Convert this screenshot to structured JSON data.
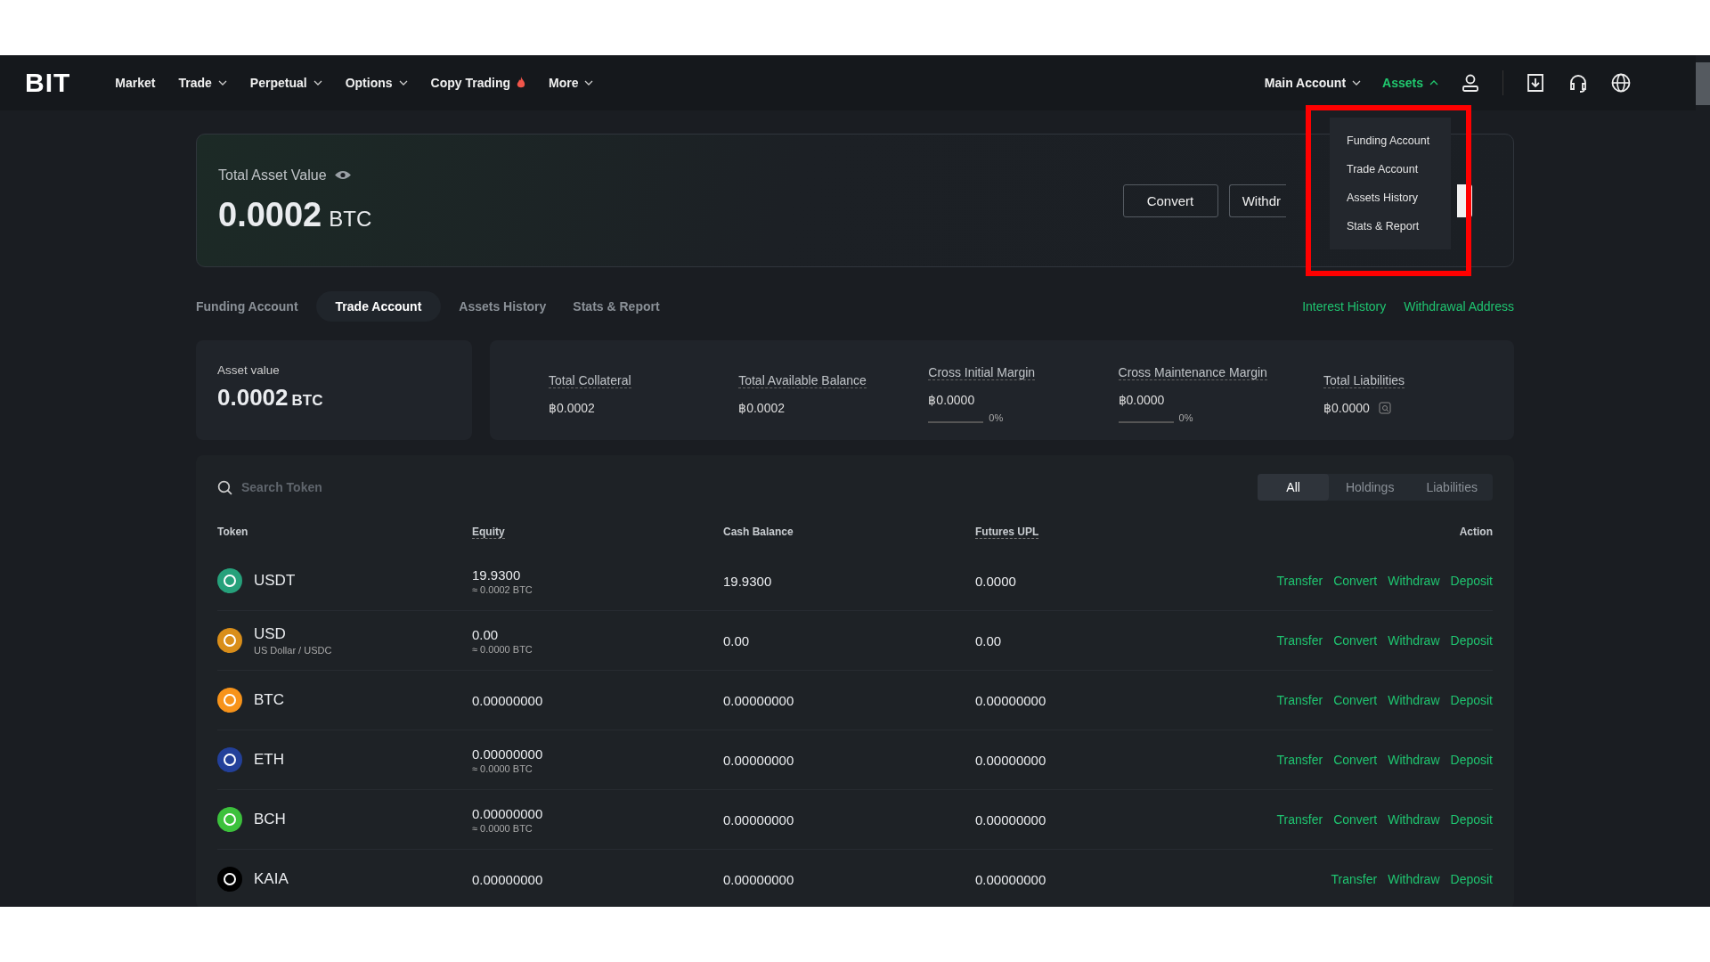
{
  "nav": {
    "logo": "BIT",
    "items": [
      {
        "label": "Market",
        "dropdown": false,
        "hot": false
      },
      {
        "label": "Trade",
        "dropdown": true,
        "hot": false
      },
      {
        "label": "Perpetual",
        "dropdown": true,
        "hot": false
      },
      {
        "label": "Options",
        "dropdown": true,
        "hot": false
      },
      {
        "label": "Copy Trading",
        "dropdown": false,
        "hot": true
      },
      {
        "label": "More",
        "dropdown": true,
        "hot": false
      }
    ],
    "account": "Main Account",
    "assets": {
      "label": "Assets",
      "expanded": true
    }
  },
  "assets_menu": {
    "items": [
      "Funding Account",
      "Trade Account",
      "Assets History",
      "Stats & Report"
    ]
  },
  "overview": {
    "title": "Total Asset Value",
    "value": "0.0002",
    "unit": "BTC",
    "buttons": [
      "Convert",
      "Withdr"
    ]
  },
  "tabs": [
    {
      "label": "Funding Account",
      "selected": false
    },
    {
      "label": "Trade Account",
      "selected": true
    },
    {
      "label": "Assets History",
      "selected": false
    },
    {
      "label": "Stats & Report",
      "selected": false
    }
  ],
  "links": [
    "Interest History",
    "Withdrawal Address"
  ],
  "asset_value": {
    "label": "Asset value",
    "value": "0.0002",
    "unit": "BTC"
  },
  "metrics": [
    {
      "kind": "plain",
      "label": "Total Collateral",
      "value": "฿0.0002"
    },
    {
      "kind": "plain",
      "label": "Total Available Balance",
      "value": "฿0.0002"
    },
    {
      "kind": "margin",
      "label": "Cross Initial Margin",
      "value": "฿0.0000",
      "level": 0,
      "percent": "0%"
    },
    {
      "kind": "margin",
      "label": "Cross Maintenance Margin",
      "value": "฿0.0000",
      "level": 0,
      "percent": "0%"
    },
    {
      "kind": "liability",
      "label": "Total Liabilities",
      "value": "฿0.0000"
    }
  ],
  "search": {
    "placeholder": "Search Token"
  },
  "filters": [
    {
      "label": "All",
      "selected": true
    },
    {
      "label": "Holdings",
      "selected": false
    },
    {
      "label": "Liabilities",
      "selected": false
    }
  ],
  "table": {
    "columns": [
      "Token",
      "Equity",
      "Cash Balance",
      "Futures UPL",
      "Action"
    ],
    "rows": [
      {
        "token": "USDT",
        "color": "#26a17b",
        "subtitle": null,
        "equity": "19.9300",
        "equity_btc": "≈ 0.0002 BTC",
        "cash": "19.9300",
        "upl": "0.0000",
        "actions": [
          "Transfer",
          "Convert",
          "Withdraw",
          "Deposit"
        ]
      },
      {
        "token": "USD",
        "color": "#d98e1a",
        "subtitle": "US Dollar / USDC",
        "equity": "0.00",
        "equity_btc": "≈ 0.0000 BTC",
        "cash": "0.00",
        "upl": "0.00",
        "actions": [
          "Transfer",
          "Convert",
          "Withdraw",
          "Deposit"
        ]
      },
      {
        "token": "BTC",
        "color": "#f7931a",
        "subtitle": null,
        "equity": "0.00000000",
        "equity_btc": null,
        "cash": "0.00000000",
        "upl": "0.00000000",
        "actions": [
          "Transfer",
          "Convert",
          "Withdraw",
          "Deposit"
        ]
      },
      {
        "token": "ETH",
        "color": "#23409a",
        "subtitle": null,
        "equity": "0.00000000",
        "equity_btc": "≈ 0.0000 BTC",
        "cash": "0.00000000",
        "upl": "0.00000000",
        "actions": [
          "Transfer",
          "Convert",
          "Withdraw",
          "Deposit"
        ]
      },
      {
        "token": "BCH",
        "color": "#3cc13c",
        "subtitle": null,
        "equity": "0.00000000",
        "equity_btc": "≈ 0.0000 BTC",
        "cash": "0.00000000",
        "upl": "0.00000000",
        "actions": [
          "Transfer",
          "Convert",
          "Withdraw",
          "Deposit"
        ]
      },
      {
        "token": "KAIA",
        "color": "#000000",
        "subtitle": null,
        "equity": "0.00000000",
        "equity_btc": null,
        "cash": "0.00000000",
        "upl": "0.00000000",
        "actions": [
          "Transfer",
          "Withdraw",
          "Deposit"
        ]
      }
    ]
  }
}
